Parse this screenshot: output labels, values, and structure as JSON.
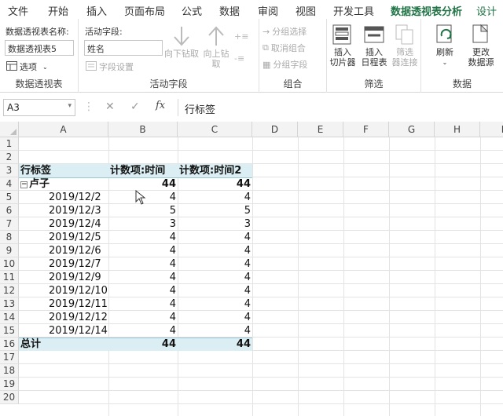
{
  "tabs": [
    "文件",
    "开始",
    "插入",
    "页面布局",
    "公式",
    "数据",
    "审阅",
    "视图",
    "开发工具",
    "数据透视表分析",
    "设计"
  ],
  "ribbon": {
    "pivot_group": {
      "name_label": "数据透视表名称:",
      "name_value": "数据透视表5",
      "options": "选项",
      "group_label": "数据透视表"
    },
    "field_group": {
      "field_label": "活动字段:",
      "field_value": "姓名",
      "field_settings": "字段设置",
      "drill_down": "向下钻取",
      "drill_up_1": "向上钻",
      "drill_up_2": "取",
      "group_label": "活动字段"
    },
    "group_group": {
      "group_selection": "分组选择",
      "ungroup": "取消组合",
      "group_field": "分组字段",
      "group_label": "组合"
    },
    "filter_group": {
      "slicer_1": "插入",
      "slicer_2": "切片器",
      "timeline_1": "插入",
      "timeline_2": "日程表",
      "conn_1": "筛选",
      "conn_2": "器连接",
      "group_label": "筛选"
    },
    "data_group": {
      "refresh": "刷新",
      "change_1": "更改",
      "change_2": "数据源",
      "group_label": "数据"
    }
  },
  "formula_bar": {
    "cell_ref": "A3",
    "fx": "fx",
    "content": "行标签"
  },
  "grid": {
    "columns": [
      "A",
      "B",
      "C",
      "D",
      "E",
      "F",
      "G",
      "H",
      "I"
    ],
    "rows": [
      "1",
      "2",
      "3",
      "4",
      "5",
      "6",
      "7",
      "8",
      "9",
      "10",
      "11",
      "12",
      "13",
      "14",
      "15",
      "16",
      "17",
      "18",
      "19",
      "20"
    ],
    "header": {
      "a": "行标签",
      "b": "计数项:时间",
      "c": "计数项:时间2"
    },
    "group_row": {
      "label": "卢子",
      "b": "44",
      "c": "44"
    },
    "data_rows": [
      {
        "date": "2019/12/2",
        "b": "4",
        "c": "4"
      },
      {
        "date": "2019/12/3",
        "b": "5",
        "c": "5"
      },
      {
        "date": "2019/12/4",
        "b": "3",
        "c": "3"
      },
      {
        "date": "2019/12/5",
        "b": "4",
        "c": "4"
      },
      {
        "date": "2019/12/6",
        "b": "4",
        "c": "4"
      },
      {
        "date": "2019/12/7",
        "b": "4",
        "c": "4"
      },
      {
        "date": "2019/12/9",
        "b": "4",
        "c": "4"
      },
      {
        "date": "2019/12/10",
        "b": "4",
        "c": "4"
      },
      {
        "date": "2019/12/11",
        "b": "4",
        "c": "4"
      },
      {
        "date": "2019/12/12",
        "b": "4",
        "c": "4"
      },
      {
        "date": "2019/12/14",
        "b": "4",
        "c": "4"
      }
    ],
    "total_row": {
      "label": "总计",
      "b": "44",
      "c": "44"
    }
  },
  "colors": {
    "accent": "#217346",
    "pivot_header": "#daeef3"
  }
}
